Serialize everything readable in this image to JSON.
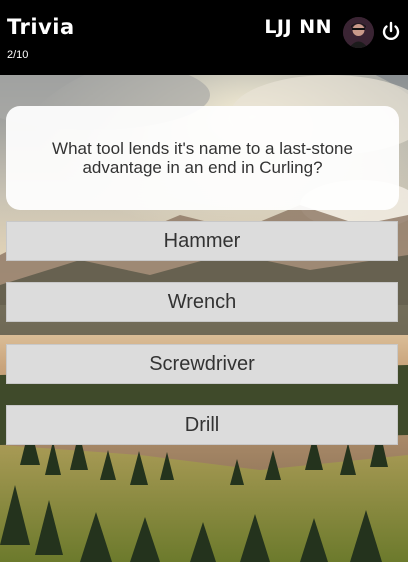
{
  "header": {
    "app_title": "Trivia",
    "progress": "2/10",
    "username": "LJJ NN",
    "avatar_icon": "user-avatar",
    "power_icon": "power-icon"
  },
  "question": {
    "text": "What tool lends it's name to a last-stone advantage in an end in Curling?"
  },
  "answers": [
    {
      "label": "Hammer"
    },
    {
      "label": "Wrench"
    },
    {
      "label": "Screwdriver"
    },
    {
      "label": "Drill"
    }
  ],
  "colors": {
    "header_bg": "#000000",
    "card_bg": "#ffffff",
    "answer_bg": "#dcdcdc",
    "text": "#333333"
  }
}
